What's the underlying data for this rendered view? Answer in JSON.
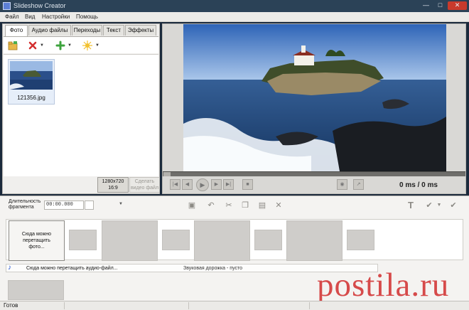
{
  "window": {
    "title": "Slideshow Creator"
  },
  "menu": [
    "Файл",
    "Вид",
    "Настройки",
    "Помощь"
  ],
  "tabs": [
    "Фото",
    "Аудио файлы",
    "Переходы",
    "Текст",
    "Эффекты"
  ],
  "active_tab": "Фото",
  "thumbnails": [
    {
      "name": "121356.jpg"
    }
  ],
  "resolution_button": {
    "line1": "1280x720",
    "line2": "16:9"
  },
  "make_video_button": {
    "line1": "Сделать",
    "line2": "видео файл"
  },
  "playback": {
    "time": "0 ms",
    "total": "/ 0 ms"
  },
  "duration": {
    "label_line1": "Длительность",
    "label_line2": "фрагмента",
    "value": "00:00.000"
  },
  "timeline": {
    "drop_line1": "Сюда можно",
    "drop_line2": "перетащить",
    "drop_line3": "фото..."
  },
  "audio": {
    "drop_text": "Сюда можно перетащить аудио-файл...",
    "status": "Звуковая дорожка - пусто"
  },
  "watermark": "postila.ru",
  "status": {
    "text": "Готов"
  },
  "colors": {
    "titlebar": "#2b4257",
    "close": "#c83a2c",
    "accent_blue": "#1c4fd1",
    "watermark": "#d64a4a"
  }
}
